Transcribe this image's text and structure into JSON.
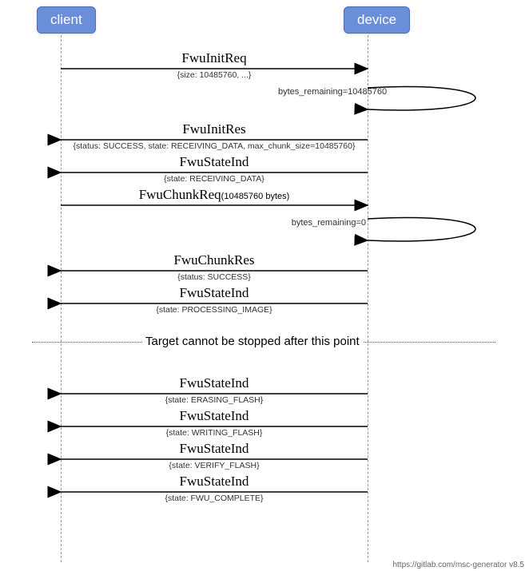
{
  "participants": {
    "client": "client",
    "device": "device"
  },
  "messages": {
    "m1": {
      "title": "FwuInitReq",
      "sub": "{size: 10485760, ...}"
    },
    "s1": {
      "label": "bytes_remaining=10485760"
    },
    "m2": {
      "title": "FwuInitRes",
      "sub": "{status: SUCCESS, state: RECEIVING_DATA, max_chunk_size=10485760}"
    },
    "m3": {
      "title": "FwuStateInd",
      "sub": "{state: RECEIVING_DATA}"
    },
    "m4": {
      "title": "FwuChunkReq",
      "suffix": "(10485760 bytes)"
    },
    "s2": {
      "label": "bytes_remaining=0"
    },
    "m5": {
      "title": "FwuChunkRes",
      "sub": "{status: SUCCESS}"
    },
    "m6": {
      "title": "FwuStateInd",
      "sub": "{state: PROCESSING_IMAGE}"
    },
    "divider": "Target cannot be stopped after this point",
    "m7": {
      "title": "FwuStateInd",
      "sub": "{state: ERASING_FLASH}"
    },
    "m8": {
      "title": "FwuStateInd",
      "sub": "{state: WRITING_FLASH}"
    },
    "m9": {
      "title": "FwuStateInd",
      "sub": "{state: VERIFY_FLASH}"
    },
    "m10": {
      "title": "FwuStateInd",
      "sub": "{state: FWU_COMPLETE}"
    }
  },
  "footer": "https://gitlab.com/msc-generator v8.5",
  "chart_data": {
    "type": "sequence-diagram",
    "participants": [
      "client",
      "device"
    ],
    "events": [
      {
        "from": "client",
        "to": "device",
        "name": "FwuInitReq",
        "params": "{size: 10485760, ...}"
      },
      {
        "from": "device",
        "to": "device",
        "note": "bytes_remaining=10485760"
      },
      {
        "from": "device",
        "to": "client",
        "name": "FwuInitRes",
        "params": "{status: SUCCESS, state: RECEIVING_DATA, max_chunk_size=10485760}"
      },
      {
        "from": "device",
        "to": "client",
        "name": "FwuStateInd",
        "params": "{state: RECEIVING_DATA}"
      },
      {
        "from": "client",
        "to": "device",
        "name": "FwuChunkReq",
        "params": "(10485760 bytes)"
      },
      {
        "from": "device",
        "to": "device",
        "note": "bytes_remaining=0"
      },
      {
        "from": "device",
        "to": "client",
        "name": "FwuChunkRes",
        "params": "{status: SUCCESS}"
      },
      {
        "from": "device",
        "to": "client",
        "name": "FwuStateInd",
        "params": "{state: PROCESSING_IMAGE}"
      },
      {
        "divider": "Target cannot be stopped after this point"
      },
      {
        "from": "device",
        "to": "client",
        "name": "FwuStateInd",
        "params": "{state: ERASING_FLASH}"
      },
      {
        "from": "device",
        "to": "client",
        "name": "FwuStateInd",
        "params": "{state: WRITING_FLASH}"
      },
      {
        "from": "device",
        "to": "client",
        "name": "FwuStateInd",
        "params": "{state: VERIFY_FLASH}"
      },
      {
        "from": "device",
        "to": "client",
        "name": "FwuStateInd",
        "params": "{state: FWU_COMPLETE}"
      }
    ]
  }
}
